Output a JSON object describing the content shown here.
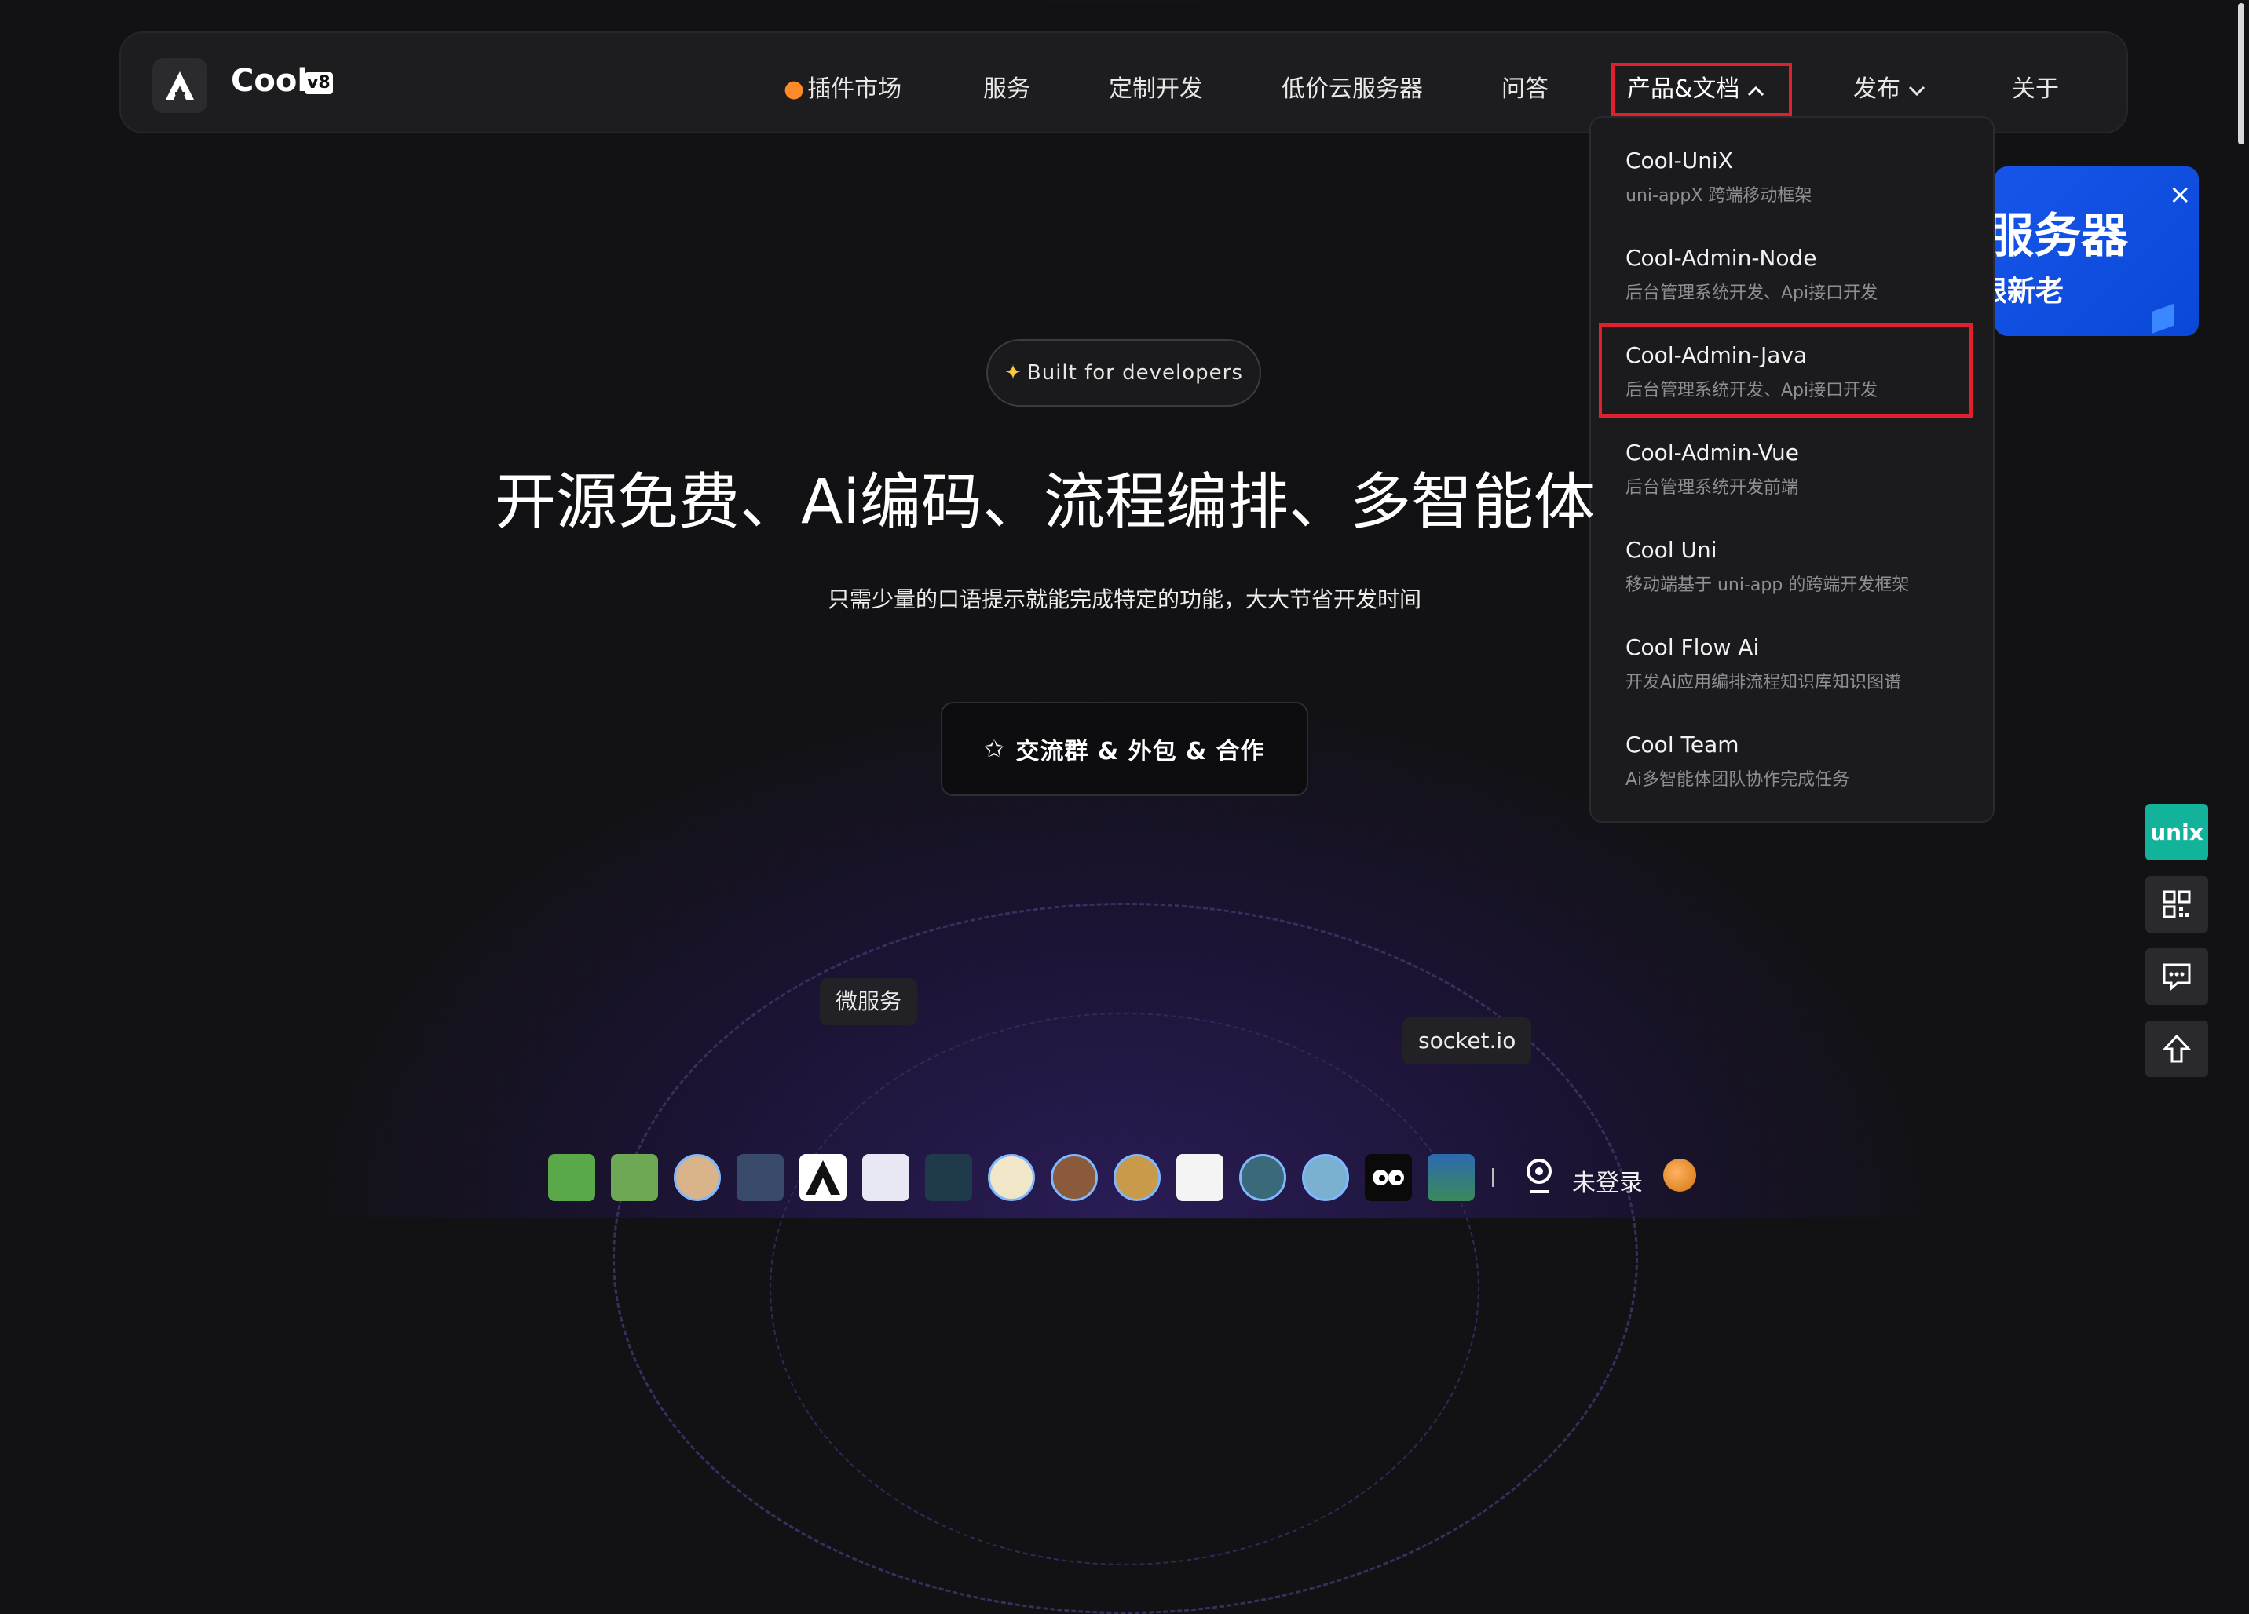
{
  "nav": {
    "logo_text": "Cool",
    "logo_badge": "v8",
    "items": [
      {
        "label": "插件市场",
        "icon": "flame-icon"
      },
      {
        "label": "服务"
      },
      {
        "label": "定制开发"
      },
      {
        "label": "低价云服务器"
      },
      {
        "label": "问答"
      },
      {
        "label": "产品&文档",
        "state": "open"
      },
      {
        "label": "发布"
      },
      {
        "label": "关于"
      }
    ]
  },
  "dropdown": {
    "items": [
      {
        "title": "Cool-UniX",
        "subtitle": "uni-appX 跨端移动框架"
      },
      {
        "title": "Cool-Admin-Node",
        "subtitle": "后台管理系统开发、Api接口开发"
      },
      {
        "title": "Cool-Admin-Java",
        "subtitle": "后台管理系统开发、Api接口开发",
        "highlighted": true
      },
      {
        "title": "Cool-Admin-Vue",
        "subtitle": "后台管理系统开发前端"
      },
      {
        "title": "Cool Uni",
        "subtitle": "移动端基于 uni-app 的跨端开发框架"
      },
      {
        "title": "Cool Flow Ai",
        "subtitle": "开发Ai应用编排流程知识库知识图谱"
      },
      {
        "title": "Cool Team",
        "subtitle": "Ai多智能体团队协作完成任务"
      }
    ]
  },
  "promo": {
    "line1": "云服务器",
    "line2": "限新老",
    "close": "×"
  },
  "hero": {
    "pill": "Built for developers",
    "headline": "开源免费、Ai编码、流程编排、多智能体",
    "subhead": "只需少量的口语提示就能完成特定的功能，大大节省开发时间",
    "cta": "交流群 & 外包 & 合作"
  },
  "tags": [
    "微服务",
    "socket.io"
  ],
  "footer": {
    "login_text": "未登录"
  },
  "side": {
    "unix": "unix"
  },
  "colors": {
    "highlight": "#e0202a",
    "accent": "#12b29b",
    "promo": "#1655e8"
  }
}
